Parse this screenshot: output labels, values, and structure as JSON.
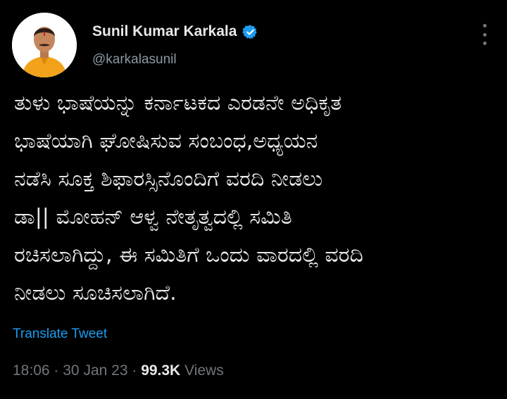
{
  "author": {
    "display_name": "Sunil Kumar Karkala",
    "handle": "@karkalasunil",
    "verified": true,
    "avatar_icon": "profile-photo-avatar"
  },
  "tweet": {
    "text": "ತುಳು ಭಾಷೆಯನ್ನು ಕರ್ನಾಟಕದ ಎರಡನೇ ಅಧಿಕೃತ\nಭಾಷೆಯಾಗಿ ಘೋಷಿಸುವ ಸಂಬಂಧ,ಅಧ್ಯಯನ\nನಡೆಸಿ ಸೂಕ್ತ ಶಿಫಾರಸ್ಸಿನೊಂದಿಗೆ ವರದಿ ನೀಡಲು\nಡಾ|| ಮೋಹನ್ ಆಳ್ವ ನೇತೃತ್ವದಲ್ಲಿ ಸಮಿತಿ\nರಚಿಸಲಾಗಿದ್ದು, ಈ ಸಮಿತಿಗೆ ಒಂದು ವಾರದಲ್ಲಿ ವರದಿ\nನೀಡಲು ಸೂಚಿಸಲಾಗಿದೆ.",
    "translate_label": "Translate Tweet",
    "time": "18:06",
    "separator": "·",
    "date": "30 Jan 23",
    "views_count": "99.3K",
    "views_label": "Views"
  },
  "icons": {
    "verified": "verified-badge-icon",
    "more": "more-options-icon"
  },
  "colors": {
    "background": "#000000",
    "text_primary": "#e7e9ea",
    "text_secondary": "#71767b",
    "accent": "#1d9bf0"
  }
}
